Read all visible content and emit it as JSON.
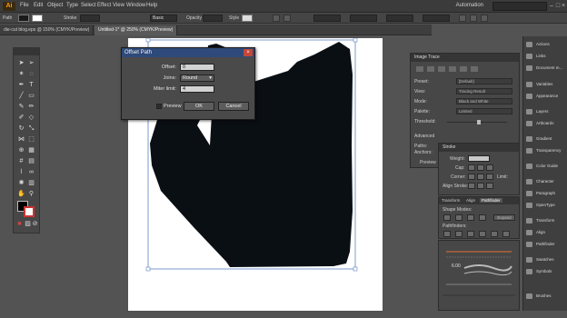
{
  "app": {
    "logo": "Ai"
  },
  "menu": [
    "File",
    "Edit",
    "Object",
    "Type",
    "Select",
    "Effect",
    "View",
    "Window",
    "Help"
  ],
  "workspace": "Automation",
  "control_bar": {
    "path_label": "Path",
    "stroke_label": "Stroke",
    "basic_label": "Basic",
    "opacity_label": "Opacity",
    "style_label": "Style"
  },
  "tabs": [
    {
      "label": "die-cut blog.eps @ 150% (CMYK/Preview)",
      "active": false
    },
    {
      "label": "Untitled-1* @ 250% (CMYK/Preview)",
      "active": true
    }
  ],
  "dialog": {
    "title": "Offset Path",
    "offset_label": "Offset:",
    "offset_value": "0",
    "joins_label": "Joins:",
    "joins_value": "Round",
    "miter_label": "Miter limit:",
    "miter_value": "4",
    "preview_label": "Preview",
    "ok_label": "OK",
    "cancel_label": "Cancel"
  },
  "image_trace": {
    "title": "Image Trace",
    "rows": [
      {
        "label": "Preset:",
        "value": "[Default]"
      },
      {
        "label": "View:",
        "value": "Tracing Result"
      },
      {
        "label": "Mode:",
        "value": "Black and White"
      },
      {
        "label": "Palette:",
        "value": "Limited"
      }
    ],
    "threshold_label": "Threshold:",
    "advanced_label": "Advanced",
    "paths_label": "Paths:",
    "anchors_label": "Anchors:",
    "preview_label": "Preview"
  },
  "stroke_panel": {
    "title": "Stroke",
    "weight_label": "Weight:",
    "cap_label": "Cap:",
    "corner_label": "Corner:",
    "limit_label": "Limit:",
    "align_label": "Align Stroke:"
  },
  "pathfinder_panel": {
    "tabs": [
      "Transform",
      "Align",
      "Pathfinder"
    ],
    "shape_modes_label": "Shape Modes:",
    "expand_label": "Expand",
    "pathfinders_label": "Pathfinders:"
  },
  "brushes_panel": {
    "size_label": "6.00"
  },
  "dock": [
    "Actions",
    "Links",
    "Document In...",
    "Variables",
    "Appearance",
    "Layers",
    "Artboards",
    "Gradient",
    "Transparency",
    "Color Guide",
    "Character",
    "Paragraph",
    "OpenType",
    "Transform",
    "Align",
    "Pathfinder",
    "Swatches",
    "Symbols",
    "Brushes"
  ],
  "colors": {
    "canvas": "#535353",
    "artboard": "#ffffff",
    "shape_fill": "#0a0f14",
    "selection": "#5b82c4",
    "brand": "#ff9a00"
  }
}
